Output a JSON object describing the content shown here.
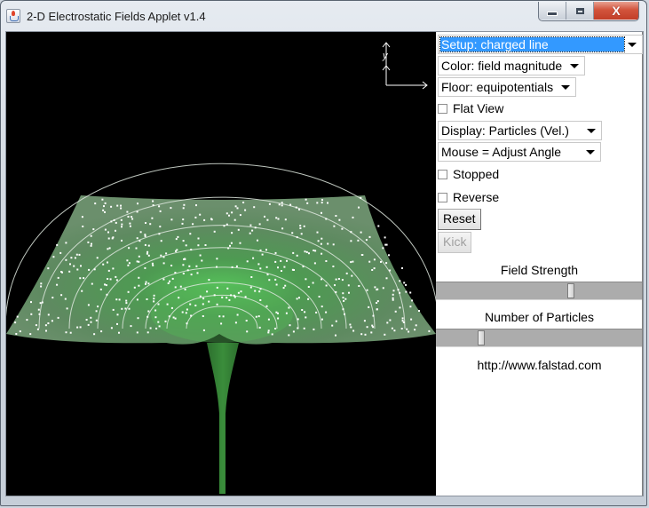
{
  "window": {
    "title": "2-D Electrostatic Fields Applet v1.4",
    "icon": "java-icon",
    "buttons": [
      {
        "name": "minimize",
        "icon": "minimize-icon"
      },
      {
        "name": "maximize",
        "icon": "maximize-icon"
      },
      {
        "name": "close",
        "icon": "close-icon",
        "glyph": "X"
      }
    ]
  },
  "view": {
    "axes": {
      "x_label": "",
      "y_label": "y"
    },
    "surface_color": "#5e8a60",
    "center_color": "#4fb84f",
    "stem_color": "#2f7a2f",
    "contour_color": "#dfe8df",
    "particle_color": "#ffffff"
  },
  "controls": {
    "setup": {
      "value": "Setup: charged line",
      "selected": true
    },
    "color": {
      "value": "Color: field magnitude"
    },
    "floor": {
      "value": "Floor: equipotentials"
    },
    "flat_view": {
      "label": "Flat View",
      "checked": false
    },
    "display": {
      "value": "Display: Particles (Vel.)"
    },
    "mouse": {
      "value": "Mouse = Adjust Angle"
    },
    "stopped": {
      "label": "Stopped",
      "checked": false
    },
    "reverse": {
      "label": "Reverse",
      "checked": false
    },
    "reset_label": "Reset",
    "kick_label": "Kick",
    "kick_enabled": false,
    "field_strength": {
      "label": "Field Strength",
      "value_fraction": 0.66
    },
    "num_particles": {
      "label": "Number of Particles",
      "value_fraction": 0.21
    },
    "link": "http://www.falstad.com"
  }
}
